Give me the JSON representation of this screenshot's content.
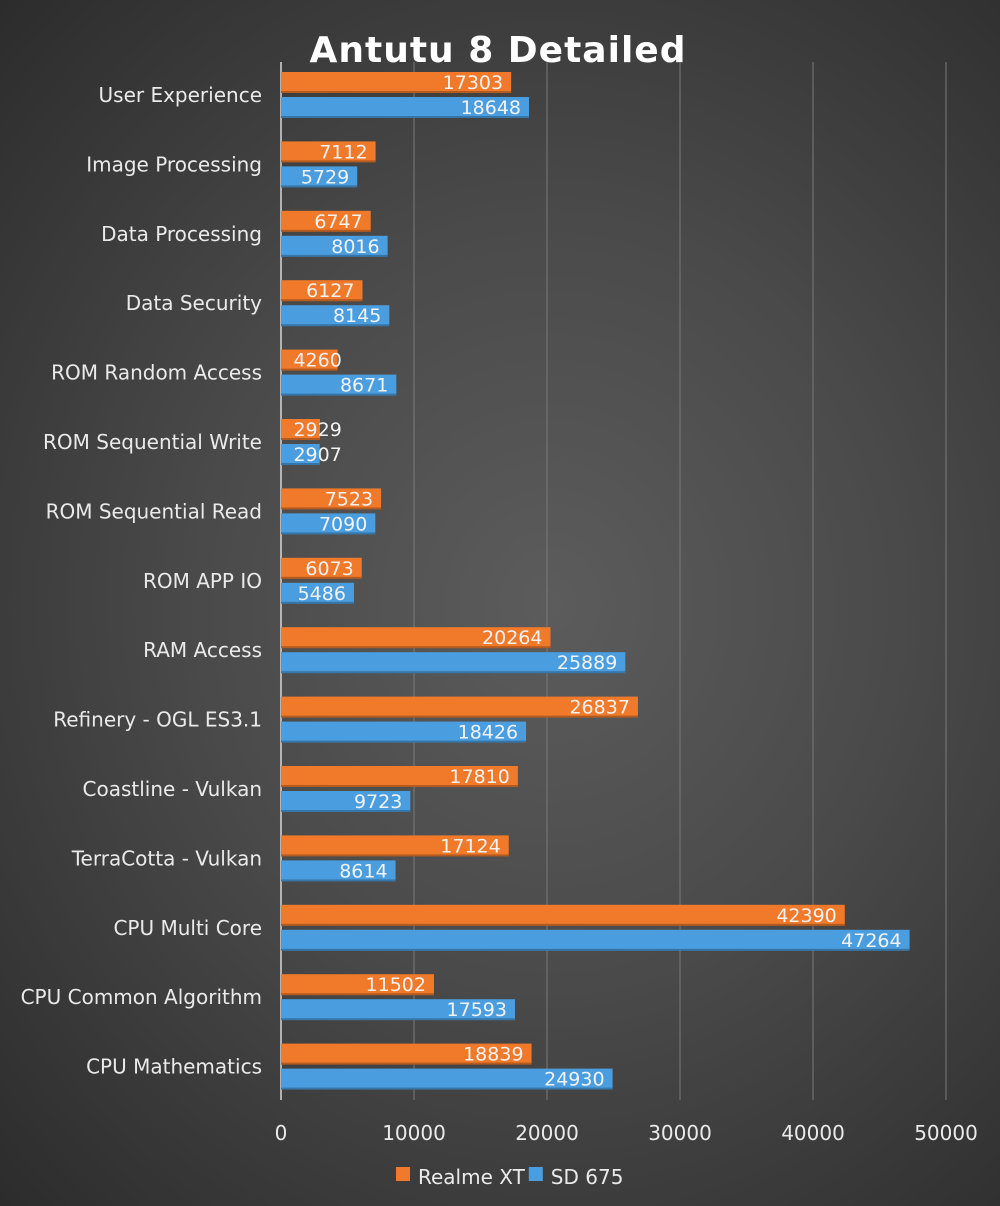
{
  "chart_data": {
    "type": "bar",
    "orientation": "horizontal",
    "title": "Antutu 8 Detailed",
    "categories": [
      "User Experience",
      "Image Processing",
      "Data Processing",
      "Data Security",
      "ROM Random Access",
      "ROM Sequential Write",
      "ROM Sequential Read",
      "ROM APP IO",
      "RAM Access",
      "Refinery - OGL ES3.1",
      "Coastline - Vulkan",
      "TerraCotta - Vulkan",
      "CPU Multi Core",
      "CPU Common Algorithm",
      "CPU Mathematics"
    ],
    "series": [
      {
        "name": "Realme XT",
        "color": "#f07a2a",
        "values": [
          17303,
          7112,
          6747,
          6127,
          4260,
          2929,
          7523,
          6073,
          20264,
          26837,
          17810,
          17124,
          42390,
          11502,
          18839
        ]
      },
      {
        "name": "SD 675",
        "color": "#4a9ee0",
        "values": [
          18648,
          5729,
          8016,
          8145,
          8671,
          2907,
          7090,
          5486,
          25889,
          18426,
          9723,
          8614,
          47264,
          17593,
          24930
        ]
      }
    ],
    "xlim": [
      0,
      50000
    ],
    "xticks": [
      "0",
      "10000",
      "20000",
      "30000",
      "40000",
      "50000"
    ],
    "grid": true,
    "legend_position": "bottom",
    "data_labels": true
  }
}
